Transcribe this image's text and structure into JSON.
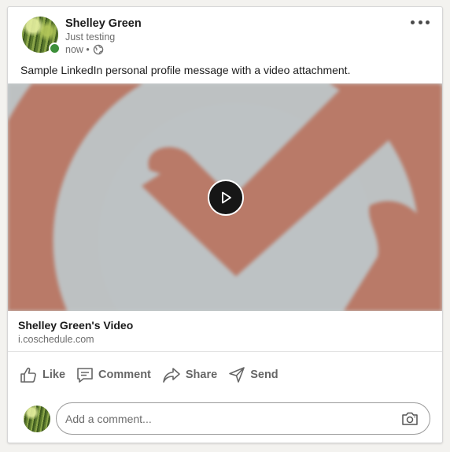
{
  "post": {
    "author": "Shelley Green",
    "subtitle": "Just testing",
    "time": "now •",
    "visibility_icon": "globe-icon",
    "message": "Sample LinkedIn personal profile message with a video attachment."
  },
  "video": {
    "title": "Shelley Green's Video",
    "link": "i.coschedule.com",
    "play_icon": "play-icon"
  },
  "actions": [
    {
      "icon": "like-icon",
      "label": "Like"
    },
    {
      "icon": "comment-icon",
      "label": "Comment"
    },
    {
      "icon": "share-icon",
      "label": "Share"
    },
    {
      "icon": "send-icon",
      "label": "Send"
    }
  ],
  "comment": {
    "placeholder": "Add a comment...",
    "camera_icon": "camera-icon"
  },
  "colors": {
    "presence": "#3d8f39",
    "video_accent": "#c27a66",
    "text_muted": "#6d6d6d"
  }
}
